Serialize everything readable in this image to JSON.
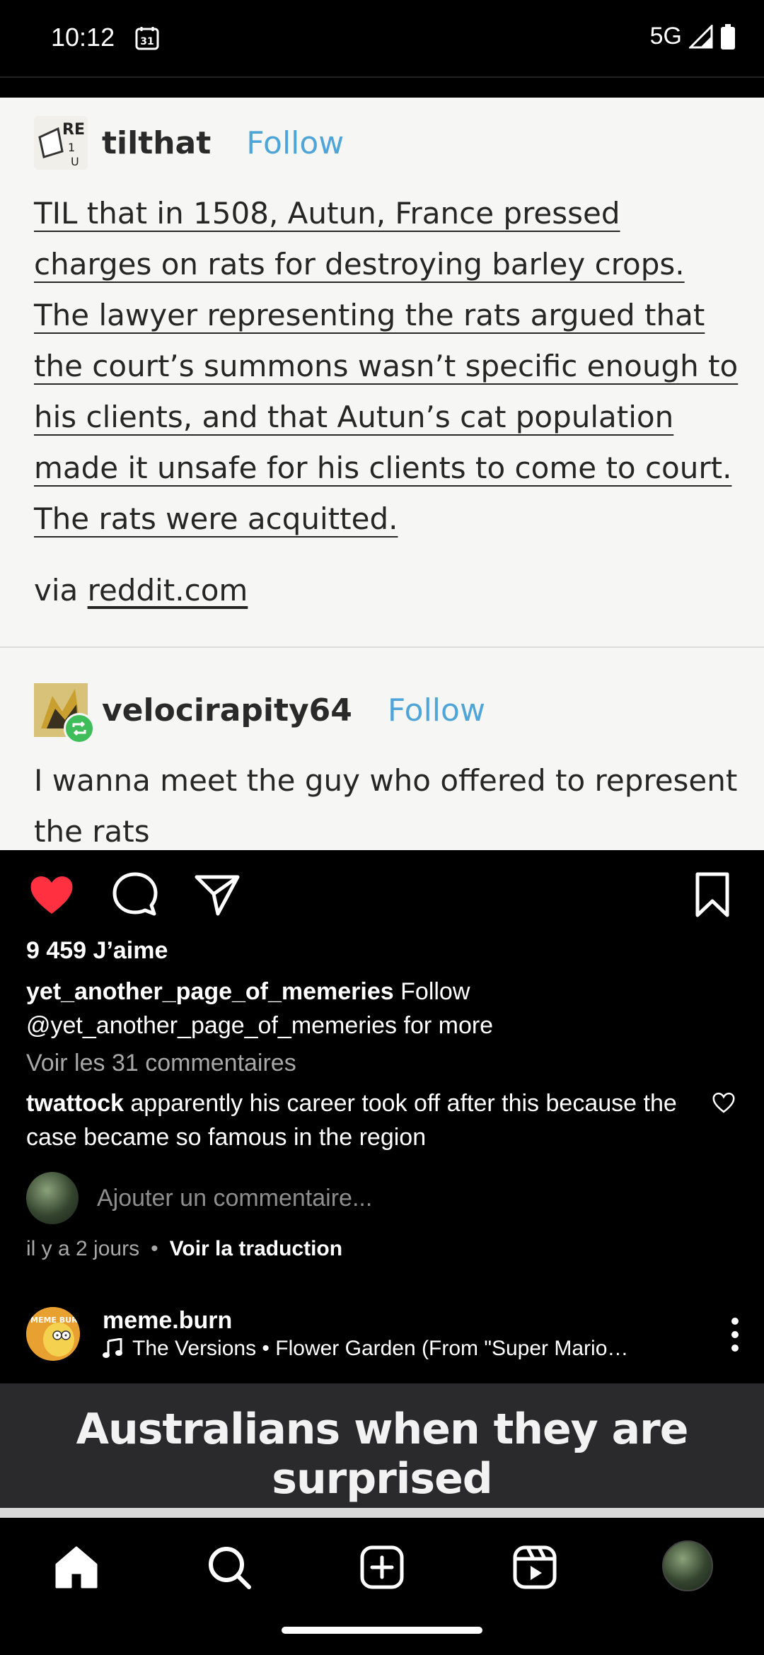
{
  "status_bar": {
    "time": "10:12",
    "calendar_day": "31",
    "network": "5G"
  },
  "tumblr_post": {
    "op_username": "tilthat",
    "op_avatar_text": "RE",
    "op_follow": "Follow",
    "body": "TIL that in 1508, Autun, France pressed charges on rats for destroying barley crops. The lawyer representing the rats argued that the court’s summons wasn’t specific enough to his clients, and that Autun’s cat population made it unsafe for his clients to come to court. The rats were acquitted.",
    "via_prefix": "via",
    "via_link": "reddit.com",
    "reply_username": "velocirapity64",
    "reply_follow": "Follow",
    "reply_text": "I wanna meet the guy who offered to represent the rats"
  },
  "post": {
    "likes": "9 459 J’aime",
    "caption_user": "yet_another_page_of_memeries",
    "caption_text": "Follow @yet_another_page_of_memeries for more",
    "view_comments": "Voir les 31 commentaires",
    "comment_user": "twattock",
    "comment_text": "apparently his career took off after this because the case became so famous in the region",
    "add_comment_placeholder": "Ajouter un commentaire...",
    "time_ago": "il y a 2 jours",
    "separator": "•",
    "translate": "Voir la traduction"
  },
  "next_post": {
    "avatar_text": "MEME BURN",
    "username": "meme.burn",
    "music": "The Versions • Flower Garden (From \"Super Mario…",
    "meme_caption": "Australians when they are surprised"
  },
  "icons": {
    "like": "heart-filled-icon",
    "comment": "comment-bubble-icon",
    "share": "paper-plane-icon",
    "save": "bookmark-icon",
    "home": "home-icon",
    "search": "search-icon",
    "create": "plus-square-icon",
    "reels": "reels-icon",
    "more": "more-vertical-icon"
  },
  "colors": {
    "like_red": "#ff3040",
    "tumblr_follow_blue": "#4fa4d8",
    "reblog_green": "#3ebd5a"
  }
}
